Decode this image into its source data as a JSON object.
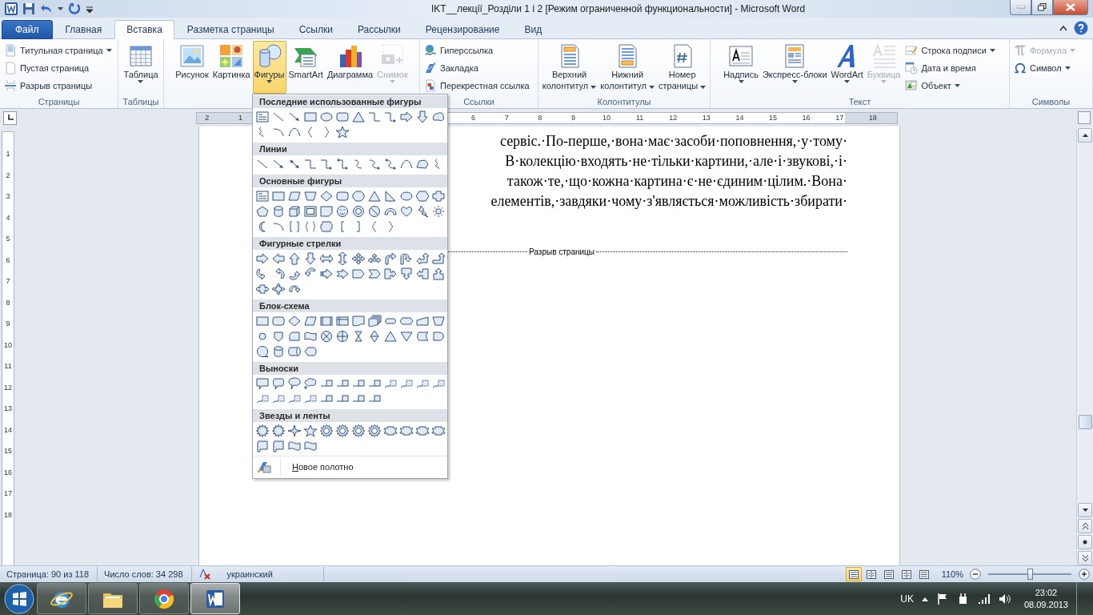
{
  "window": {
    "title": "IKT__лекції_Розділи 1 і 2 [Режим ограниченной функциональности]  -  Microsoft Word"
  },
  "tabs": [
    {
      "label": "Файл",
      "kind": "file",
      "selected": false
    },
    {
      "label": "Главная",
      "kind": "tab",
      "selected": false
    },
    {
      "label": "Вставка",
      "kind": "tab",
      "selected": true
    },
    {
      "label": "Разметка страницы",
      "kind": "tab",
      "selected": false
    },
    {
      "label": "Ссылки",
      "kind": "tab",
      "selected": false
    },
    {
      "label": "Рассылки",
      "kind": "tab",
      "selected": false
    },
    {
      "label": "Рецензирование",
      "kind": "tab",
      "selected": false
    },
    {
      "label": "Вид",
      "kind": "tab",
      "selected": false
    }
  ],
  "ribbon": {
    "groups": [
      {
        "label": "Страницы",
        "items": [
          {
            "kind": "small",
            "lines": [
              "Титульная страница"
            ],
            "dropdown": true,
            "disabled": false
          },
          {
            "kind": "small",
            "lines": [
              "Пустая страница"
            ],
            "dropdown": false,
            "disabled": false
          },
          {
            "kind": "small",
            "lines": [
              "Разрыв страницы"
            ],
            "dropdown": false,
            "disabled": false
          }
        ]
      },
      {
        "label": "Таблицы",
        "items": [
          {
            "kind": "large",
            "lines": [
              "Таблица"
            ],
            "dropdown": true,
            "disabled": false
          }
        ]
      },
      {
        "items": [
          {
            "kind": "large",
            "lines": [
              "Рисунок"
            ],
            "dropdown": false,
            "disabled": false,
            "pressed": false
          },
          {
            "kind": "large",
            "lines": [
              "Картинка"
            ],
            "dropdown": false,
            "disabled": false,
            "pressed": false
          },
          {
            "kind": "large",
            "lines": [
              "Фигуры"
            ],
            "dropdown": true,
            "disabled": false,
            "pressed": true
          },
          {
            "kind": "large",
            "lines": [
              "SmartArt"
            ],
            "dropdown": false,
            "disabled": false,
            "pressed": false
          },
          {
            "kind": "large",
            "lines": [
              "Диаграмма"
            ],
            "dropdown": false,
            "disabled": false,
            "pressed": false
          },
          {
            "kind": "large",
            "lines": [
              "Снимок"
            ],
            "dropdown": true,
            "disabled": true,
            "pressed": false
          }
        ]
      },
      {
        "label": "Ссылки",
        "items": [
          {
            "kind": "small",
            "lines": [
              "Гиперссылка"
            ],
            "dropdown": false,
            "disabled": false
          },
          {
            "kind": "small",
            "lines": [
              "Закладка"
            ],
            "dropdown": false,
            "disabled": false
          },
          {
            "kind": "small",
            "lines": [
              "Перекрестная ссылка"
            ],
            "dropdown": false,
            "disabled": false
          }
        ]
      },
      {
        "label": "Колонтитулы",
        "items": [
          {
            "kind": "large",
            "lines": [
              "Верхний",
              "колонтитул"
            ],
            "dropdown": true,
            "disabled": false
          },
          {
            "kind": "large",
            "lines": [
              "Нижний",
              "колонтитул"
            ],
            "dropdown": true,
            "disabled": false
          },
          {
            "kind": "large",
            "lines": [
              "Номер",
              "страницы"
            ],
            "dropdown": true,
            "disabled": false
          }
        ]
      },
      {
        "label": "Текст",
        "items": [
          {
            "kind": "large",
            "lines": [
              "Надпись"
            ],
            "dropdown": true,
            "disabled": false
          },
          {
            "kind": "large",
            "lines": [
              "Экспресс-блоки"
            ],
            "dropdown": true,
            "disabled": false
          },
          {
            "kind": "large",
            "lines": [
              "WordArt"
            ],
            "dropdown": true,
            "disabled": false
          },
          {
            "kind": "large",
            "lines": [
              "Буквица"
            ],
            "dropdown": true,
            "disabled": true
          },
          {
            "kind": "small",
            "lines": [
              "Строка подписи"
            ],
            "dropdown": true,
            "disabled": false
          },
          {
            "kind": "small",
            "lines": [
              "Дата и время"
            ],
            "dropdown": false,
            "disabled": false
          },
          {
            "kind": "small",
            "lines": [
              "Объект"
            ],
            "dropdown": true,
            "disabled": false
          }
        ]
      },
      {
        "label": "Символы",
        "items": [
          {
            "kind": "small",
            "lines": [
              "Формула"
            ],
            "dropdown": true,
            "disabled": true
          },
          {
            "kind": "small",
            "lines": [
              "Символ"
            ],
            "dropdown": true,
            "disabled": false
          }
        ]
      }
    ]
  },
  "ruler": {
    "left_numbers": [
      "2",
      "1"
    ],
    "right_numbers": [
      "6",
      "7",
      "8",
      "9",
      "10",
      "11",
      "12",
      "13",
      "14",
      "15",
      "16",
      "17",
      "18"
    ]
  },
  "vertical_ruler": {
    "numbers": [
      "1",
      "2",
      "3",
      "4",
      "5",
      "6",
      "7",
      "8",
      "9",
      "10",
      "11",
      "12",
      "13",
      "14",
      "15",
      "16",
      "17",
      "18"
    ]
  },
  "document": {
    "lines": [
      "сервіс.·По-перше,·вона·має·засоби·поповнення,·у·тому·",
      "В·колекцію·входять·не·тільки·картини,·але·і·звукові,·і·",
      "також·те,·що·кожна·картина·є·не·єдиним·цілим.·Вона·",
      "елементів,·завдяки·чому·з'являється·можливість·збирати·"
    ],
    "page_break": "Разрыв страницы"
  },
  "shapes_menu": {
    "sections": [
      {
        "title": "Последние использованные фигуры"
      },
      {
        "title": "Линии"
      },
      {
        "title": "Основные фигуры"
      },
      {
        "title": "Фигурные стрелки"
      },
      {
        "title": "Блок-схема"
      },
      {
        "title": "Выноски"
      },
      {
        "title": "Звезды и ленты"
      }
    ],
    "footer": "Новое полотно"
  },
  "status_bar": {
    "page": "Страница: 90 из 118",
    "words": "Число слов: 34 298",
    "language": "украинский",
    "views": [
      {
        "selected": true
      },
      {
        "selected": false
      },
      {
        "selected": false
      },
      {
        "selected": false
      },
      {
        "selected": false
      }
    ],
    "zoom": "110%",
    "zoom_slider": {
      "level": 0.5
    }
  },
  "taskbar": {
    "apps": [
      {
        "active": false
      },
      {
        "active": false
      },
      {
        "active": false
      },
      {
        "active": true
      }
    ],
    "language": "UK",
    "time": "23:02",
    "date": "08.09.2013"
  }
}
